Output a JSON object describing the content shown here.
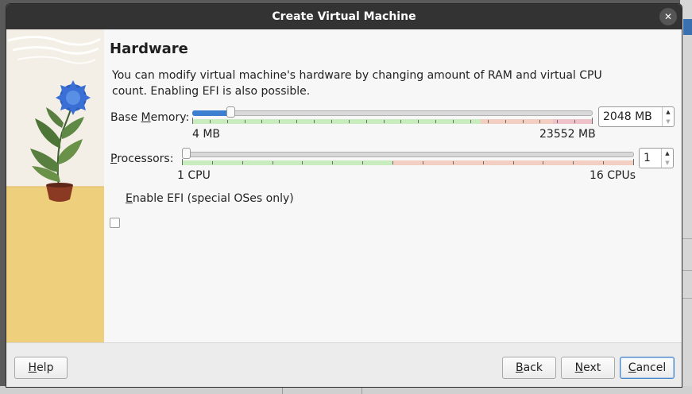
{
  "window": {
    "title": "Create Virtual Machine",
    "close_glyph": "✕"
  },
  "page": {
    "heading": "Hardware",
    "description": "You can modify virtual machine's hardware by changing amount of RAM and virtual CPU count. Enabling EFI is also possible."
  },
  "memory": {
    "label_pre": "Base ",
    "label_key": "M",
    "label_post": "emory:",
    "min_label": "4 MB",
    "max_label": "23552 MB",
    "min": 4,
    "max": 23552,
    "value": 2048,
    "value_text": "2048 MB"
  },
  "processors": {
    "label_key": "P",
    "label_post": "rocessors:",
    "min_label": "1 CPU",
    "max_label": "16 CPUs",
    "min": 1,
    "max": 16,
    "value": 1,
    "value_text": "1"
  },
  "efi": {
    "label_key": "E",
    "label_post": "nable EFI (special OSes only)",
    "checked": false
  },
  "buttons": {
    "help": {
      "key": "H",
      "rest": "elp"
    },
    "back": {
      "key": "B",
      "rest": "ack"
    },
    "next": {
      "key": "N",
      "rest": "ext"
    },
    "cancel": {
      "key": "C",
      "rest": "ancel"
    }
  },
  "colors": {
    "titlebar": "#333333",
    "slider_fill": "#3c7fd0",
    "zone_ok": "#c9ecbf",
    "zone_warn": "#f3cfc3",
    "zone_bad": "#efc2c9",
    "art_sand": "#edcf7c",
    "art_sky": "#f3efe6"
  },
  "icons": {
    "close": "close-icon",
    "spin_up": "spin-up-icon",
    "spin_down": "spin-down-icon",
    "cursor": "mouse-cursor-icon"
  }
}
